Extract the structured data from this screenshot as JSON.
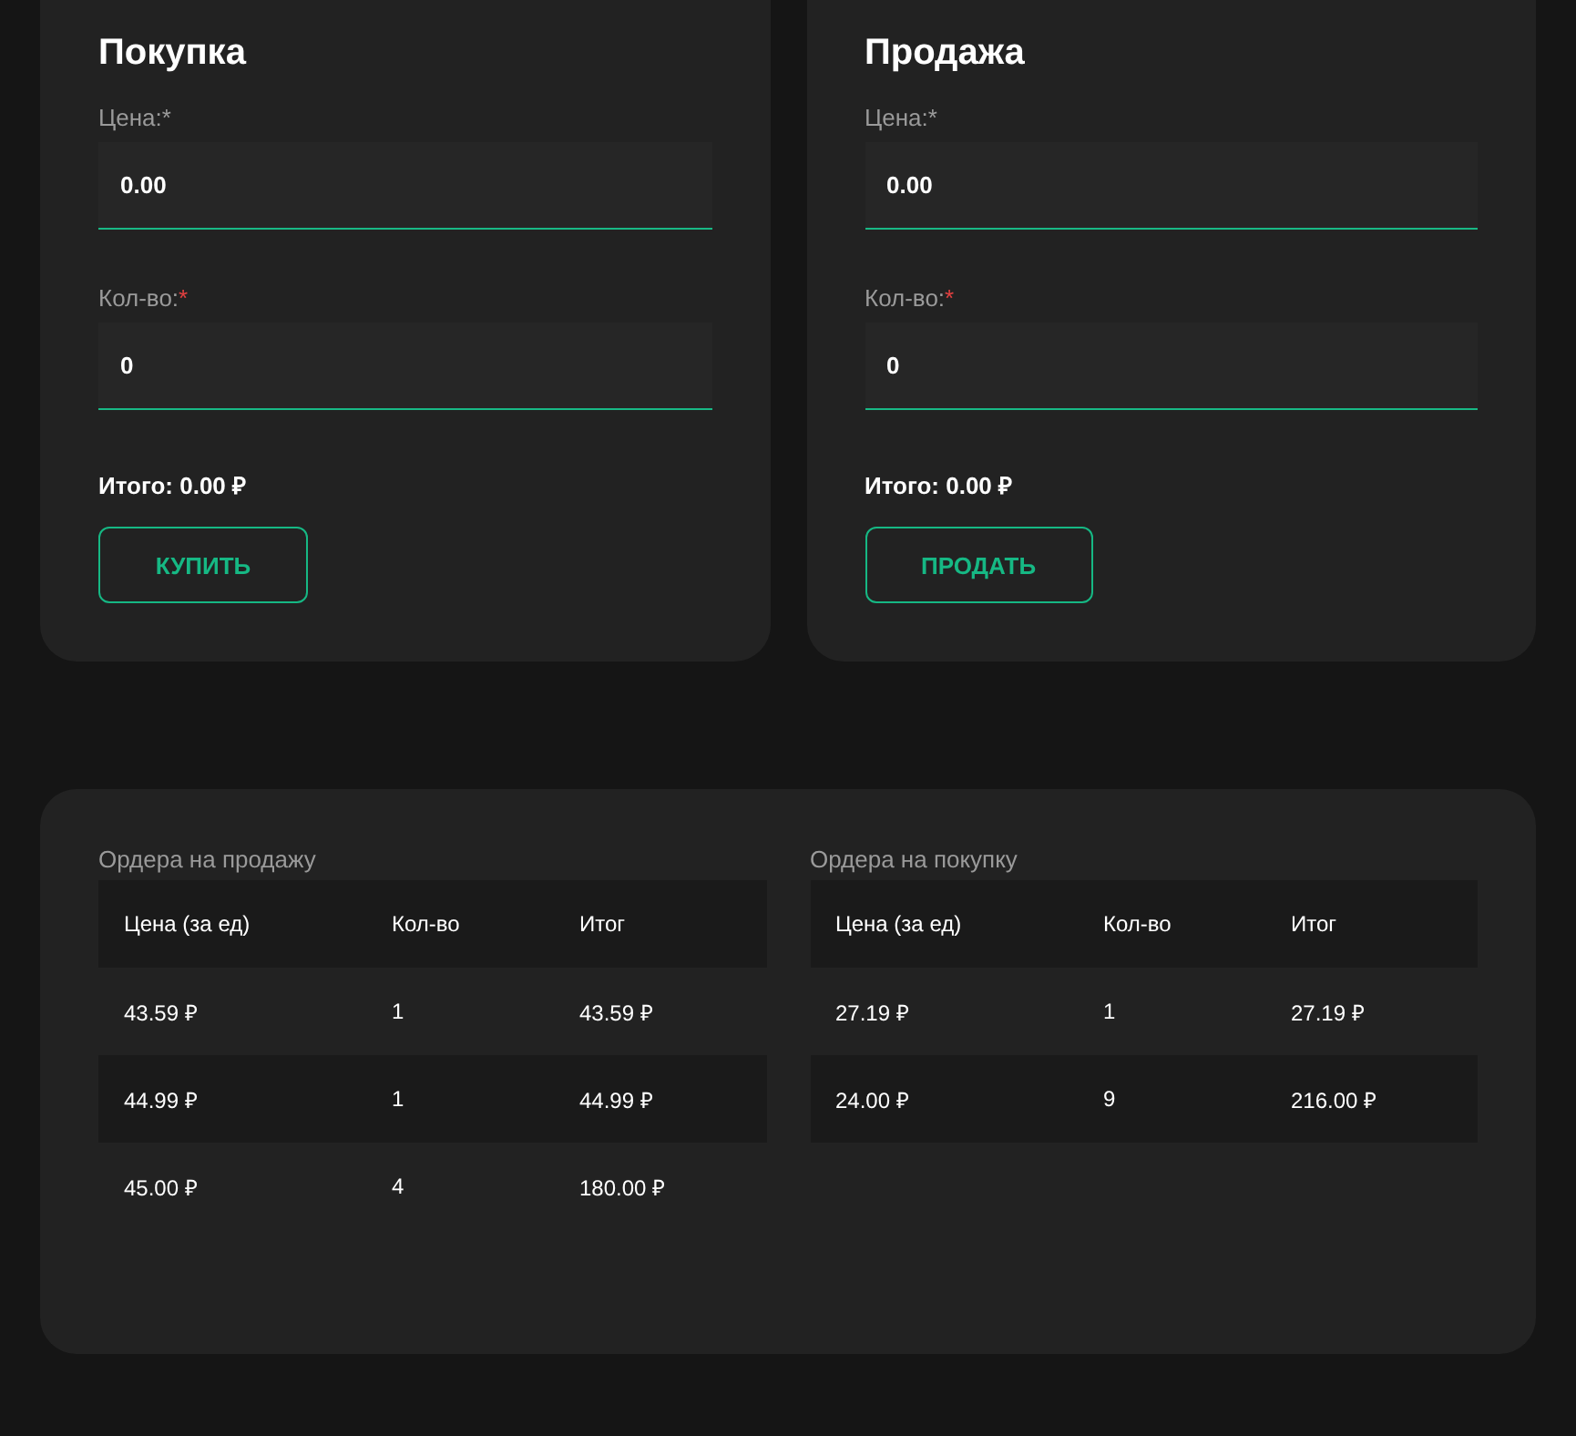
{
  "trade_panels": [
    {
      "title": "Покупка",
      "fields": [
        {
          "label": "Цена:",
          "mark": "*",
          "invalid": false,
          "value": "0.00"
        },
        {
          "label": "Кол-во:",
          "mark": "*",
          "invalid": true,
          "value": "0"
        }
      ],
      "total": "Итого: 0.00 ₽",
      "button": "КУПИТЬ"
    },
    {
      "title": "Продажа",
      "fields": [
        {
          "label": "Цена:",
          "mark": "*",
          "invalid": false,
          "value": "0.00"
        },
        {
          "label": "Кол-во:",
          "mark": "*",
          "invalid": true,
          "value": "0"
        }
      ],
      "total": "Итого: 0.00 ₽",
      "button": "ПРОДАТЬ"
    }
  ],
  "order_books": [
    {
      "title": "Ордера на продажу",
      "columns": [
        "Цена (за ед)",
        "Кол-во",
        "Итог"
      ],
      "rows": [
        [
          "43.59 ₽",
          "1",
          "43.59  ₽"
        ],
        [
          "44.99 ₽",
          "1",
          "44.99  ₽"
        ],
        [
          "45.00 ₽",
          "4",
          "180.00  ₽"
        ]
      ]
    },
    {
      "title": "Ордера на покупку",
      "columns": [
        "Цена (за ед)",
        "Кол-во",
        "Итог"
      ],
      "rows": [
        [
          "27.19 ₽",
          "1",
          "27.19  ₽"
        ],
        [
          "24.00 ₽",
          "9",
          "216.00  ₽"
        ]
      ]
    }
  ]
}
